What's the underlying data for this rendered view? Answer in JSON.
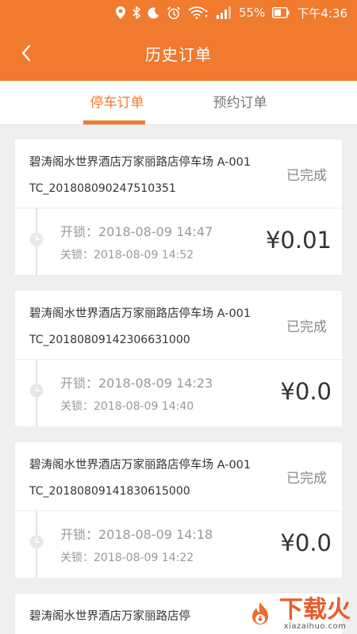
{
  "status_bar": {
    "battery": "55%",
    "time": "下午4:36"
  },
  "header": {
    "title": "历史订单"
  },
  "tabs": [
    {
      "label": "停车订单",
      "active": true
    },
    {
      "label": "预约订单",
      "active": false
    }
  ],
  "orders": [
    {
      "lot": "碧涛阁水世界酒店万家丽路店停车场 A-001",
      "code": "TC_201808090247510351",
      "status": "已完成",
      "unlock": "开锁：2018-08-09 14:47",
      "lock": "关锁：2018-08-09 14:52",
      "amount": "¥0.01"
    },
    {
      "lot": "碧涛阁水世界酒店万家丽路店停车场 A-001",
      "code": "TC_20180809142306631000",
      "status": "已完成",
      "unlock": "开锁：2018-08-09 14:23",
      "lock": "关锁：2018-08-09 14:40",
      "amount": "¥0.0"
    },
    {
      "lot": "碧涛阁水世界酒店万家丽路店停车场 A-001",
      "code": "TC_20180809141830615000",
      "status": "已完成",
      "unlock": "开锁：2018-08-09 14:18",
      "lock": "关锁：2018-08-09 14:22",
      "amount": "¥0.0"
    },
    {
      "lot": "碧涛阁水世界酒店万家丽路店停"
    }
  ],
  "watermark": {
    "brand": "下载火",
    "domain": "xiazaihuo.com"
  },
  "colors": {
    "accent": "#f07a2e",
    "background": "#efefef"
  }
}
